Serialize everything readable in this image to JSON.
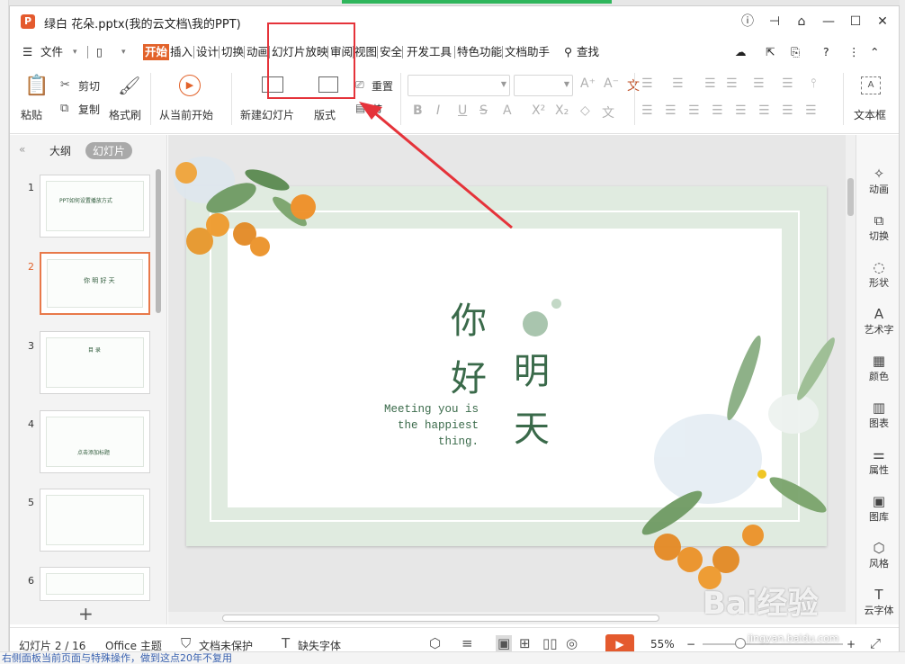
{
  "window": {
    "title": "绿白 花朵.pptx(我的云文档\\我的PPT)",
    "app_logo": "P"
  },
  "menu": {
    "file": "文件",
    "tabs": [
      "开始",
      "插入",
      "设计",
      "切换",
      "动画",
      "幻灯片放映",
      "审阅",
      "视图",
      "安全",
      "开发工具",
      "特色功能",
      "文档助手"
    ],
    "active_tab": "开始",
    "search": "查找"
  },
  "ribbon": {
    "paste": "粘贴",
    "cut": "剪切",
    "copy": "复制",
    "format_painter": "格式刷",
    "from_current": "从当前开始",
    "new_slide": "新建幻灯片",
    "layout": "版式",
    "reset": "重置",
    "section": "节",
    "textbox": "文本框"
  },
  "left_panel": {
    "tab_outline": "大纲",
    "tab_slides": "幻灯片",
    "slides": [
      {
        "num": "1",
        "text": "PPT如何设置播放方式"
      },
      {
        "num": "2",
        "text": "你 明 好 天"
      },
      {
        "num": "3",
        "text": "目 录"
      },
      {
        "num": "4",
        "text": "点击添加标题"
      },
      {
        "num": "5",
        "text": ""
      },
      {
        "num": "6",
        "text": ""
      }
    ],
    "selected_index": 1
  },
  "slide": {
    "char_ni": "你",
    "char_hao": "好",
    "char_ming": "明",
    "char_tian": "天",
    "tagline": "Meeting you is\nthe happiest\n thing."
  },
  "right_panel": {
    "items": [
      "动画",
      "切换",
      "形状",
      "艺术字",
      "颜色",
      "图表",
      "属性",
      "图库",
      "风格",
      "云字体"
    ]
  },
  "status": {
    "slide_count": "幻灯片 2 / 16",
    "theme": "Office 主题",
    "protection": "文档未保护",
    "missing_fonts": "缺失字体",
    "zoom": "55%"
  },
  "watermark": {
    "brand": "Bai经验",
    "url": "jingyan.baidu.com"
  },
  "bottom_strip": "右侧面板当前页面与特殊操作，做到这点20年不复用",
  "colors": {
    "accent": "#e2622a",
    "highlight": "#e5333a",
    "slide_green": "#3a6a4a"
  }
}
